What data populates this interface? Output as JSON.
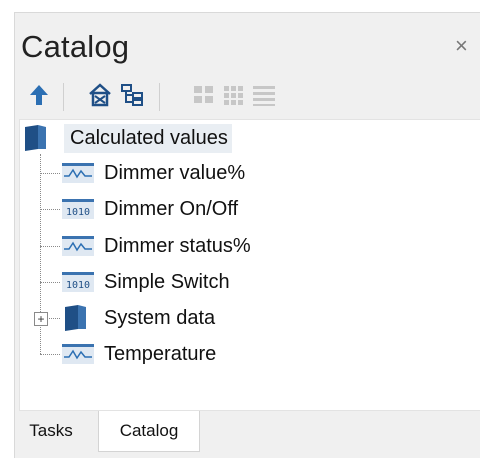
{
  "panel": {
    "title": "Catalog",
    "close_glyph": "×"
  },
  "toolbar": {
    "buttons": [
      {
        "name": "up-arrow-icon"
      },
      {
        "name": "building-icon"
      },
      {
        "name": "tree-structure-icon"
      },
      {
        "name": "large-icons-view-icon"
      },
      {
        "name": "small-icons-view-icon"
      },
      {
        "name": "list-view-icon"
      }
    ]
  },
  "tree": {
    "root": {
      "label": "Calculated values",
      "icon": "folder-icon"
    },
    "items": [
      {
        "label": "Dimmer value%",
        "icon": "analog-value-icon"
      },
      {
        "label": "Dimmer On/Off",
        "icon": "binary-value-icon"
      },
      {
        "label": "Dimmer status%",
        "icon": "analog-value-icon"
      },
      {
        "label": "Simple Switch",
        "icon": "binary-value-icon"
      },
      {
        "label": "System data",
        "icon": "folder-icon",
        "expandable": true,
        "expand_glyph": "+"
      },
      {
        "label": "Temperature",
        "icon": "analog-value-icon"
      }
    ]
  },
  "tabs": [
    {
      "label": "Tasks",
      "active": false
    },
    {
      "label": "Catalog",
      "active": true
    }
  ],
  "colors": {
    "panel_bg": "#f0f0f0",
    "icon_blue": "#2c6fb3",
    "folder_blue": "#1f4f86",
    "toolbar_gray": "#c7c7c7",
    "selection_bg": "#e9eef3"
  }
}
